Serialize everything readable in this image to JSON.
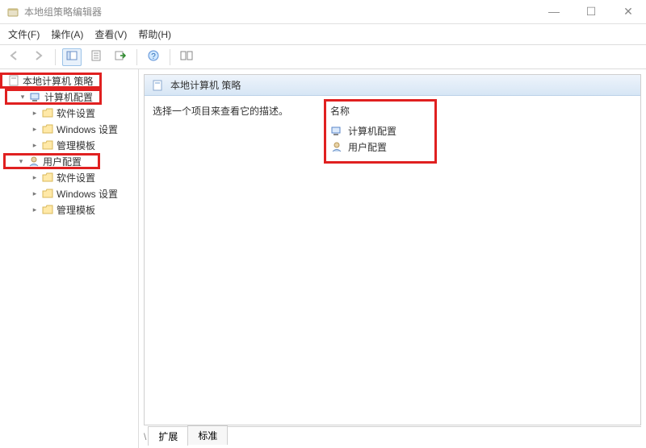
{
  "window": {
    "title": "本地组策略编辑器"
  },
  "menu": {
    "file": "文件(F)",
    "action": "操作(A)",
    "view": "查看(V)",
    "help": "帮助(H)"
  },
  "toolbar": {
    "back": "back-icon",
    "forward": "forward-icon",
    "up": "up-icon",
    "props": "properties-icon",
    "refresh": "refresh-icon",
    "help": "help-icon",
    "split": "split-icon"
  },
  "tree": {
    "root": "本地计算机 策略",
    "computer": {
      "label": "计算机配置",
      "children": {
        "software": "软件设置",
        "windows": "Windows 设置",
        "admin": "管理模板"
      }
    },
    "user": {
      "label": "用户配置",
      "children": {
        "software": "软件设置",
        "windows": "Windows 设置",
        "admin": "管理模板"
      }
    }
  },
  "panel": {
    "header": "本地计算机 策略",
    "description": "选择一个项目来查看它的描述。",
    "columns": {
      "name": "名称"
    },
    "items": {
      "computer": "计算机配置",
      "user": "用户配置"
    }
  },
  "tabs": {
    "extended": "扩展",
    "standard": "标准"
  }
}
